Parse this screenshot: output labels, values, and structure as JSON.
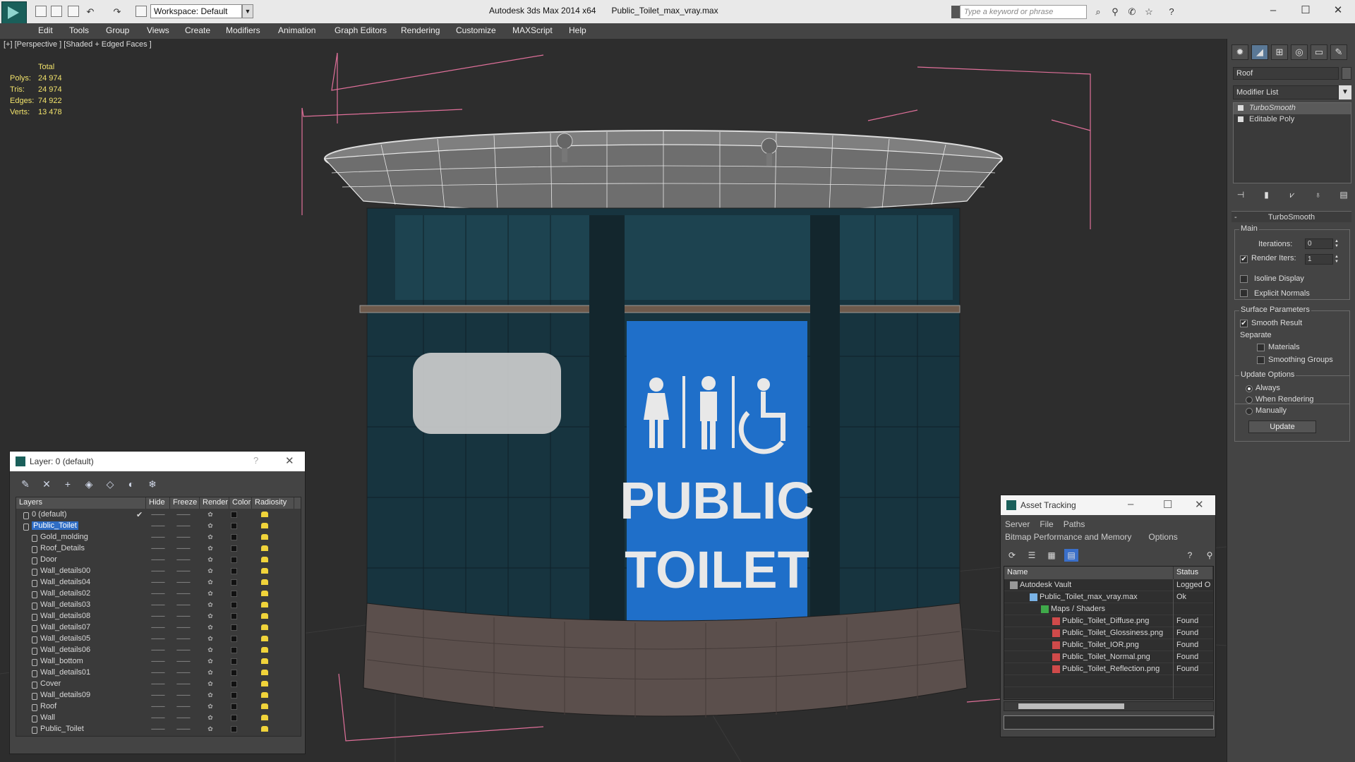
{
  "titlebar": {
    "workspace": "Workspace: Default",
    "app_title": "Autodesk 3ds Max  2014 x64",
    "file_name": "Public_Toilet_max_vray.max",
    "search_placeholder": "Type a keyword or phrase"
  },
  "menu": [
    "Edit",
    "Tools",
    "Group",
    "Views",
    "Create",
    "Modifiers",
    "Animation",
    "Graph Editors",
    "Rendering",
    "Customize",
    "MAXScript",
    "Help"
  ],
  "viewport": {
    "label": "[+] [Perspective ] [Shaded + Edged Faces ]",
    "stats": {
      "header": "Total",
      "rows": [
        {
          "k": "Polys:",
          "v": "24 974"
        },
        {
          "k": "Tris:",
          "v": "24 974"
        },
        {
          "k": "Edges:",
          "v": "74 922"
        },
        {
          "k": "Verts:",
          "v": "13 478"
        }
      ]
    },
    "sign": {
      "line1": "PUBLIC",
      "line2": "TOILET"
    }
  },
  "command_panel": {
    "object_name": "Roof",
    "modifier_list": "Modifier List",
    "stack": [
      "TurboSmooth",
      "Editable Poly"
    ],
    "rollout_title": "TurboSmooth",
    "main_group": "Main",
    "iterations_label": "Iterations:",
    "iterations_value": "0",
    "render_iters_label": "Render Iters:",
    "render_iters_value": "1",
    "isoline_display": "Isoline Display",
    "explicit_normals": "Explicit Normals",
    "surface_group": "Surface Parameters",
    "smooth_result": "Smooth Result",
    "separate_label": "Separate",
    "materials": "Materials",
    "smoothing_groups": "Smoothing Groups",
    "update_group": "Update Options",
    "always": "Always",
    "when_rendering": "When Rendering",
    "manually": "Manually",
    "update_button": "Update"
  },
  "layer_dialog": {
    "title": "Layer: 0 (default)",
    "help": "?",
    "columns": [
      "Layers",
      "Hide",
      "Freeze",
      "Render",
      "Color",
      "Radiosity"
    ],
    "layers": [
      {
        "name": "0 (default)",
        "level": 0,
        "check": "✔"
      },
      {
        "name": "Public_Toilet",
        "level": 0,
        "selected": true
      },
      {
        "name": "Gold_molding",
        "level": 1
      },
      {
        "name": "Roof_Details",
        "level": 1
      },
      {
        "name": "Door",
        "level": 1
      },
      {
        "name": "Wall_details00",
        "level": 1
      },
      {
        "name": "Wall_details04",
        "level": 1
      },
      {
        "name": "Wall_details02",
        "level": 1
      },
      {
        "name": "Wall_details03",
        "level": 1
      },
      {
        "name": "Wall_details08",
        "level": 1
      },
      {
        "name": "Wall_details07",
        "level": 1
      },
      {
        "name": "Wall_details05",
        "level": 1
      },
      {
        "name": "Wall_details06",
        "level": 1
      },
      {
        "name": "Wall_bottom",
        "level": 1
      },
      {
        "name": "Wall_details01",
        "level": 1
      },
      {
        "name": "Cover",
        "level": 1
      },
      {
        "name": "Wall_details09",
        "level": 1
      },
      {
        "name": "Roof",
        "level": 1
      },
      {
        "name": "Wall",
        "level": 1
      },
      {
        "name": "Public_Toilet",
        "level": 1
      }
    ]
  },
  "asset_tracking": {
    "title": "Asset Tracking",
    "menu1": [
      "Server",
      "File",
      "Paths"
    ],
    "menu2": [
      "Bitmap Performance and Memory",
      "Options"
    ],
    "columns": [
      "Name",
      "Status"
    ],
    "rows": [
      {
        "name": "Autodesk Vault",
        "status": "Logged O",
        "indent": 8,
        "icon": "vault"
      },
      {
        "name": "Public_Toilet_max_vray.max",
        "status": "Ok",
        "indent": 36,
        "icon": "max"
      },
      {
        "name": "Maps / Shaders",
        "status": "",
        "indent": 52,
        "icon": "folder"
      },
      {
        "name": "Public_Toilet_Diffuse.png",
        "status": "Found",
        "indent": 68,
        "icon": "png"
      },
      {
        "name": "Public_Toilet_Glossiness.png",
        "status": "Found",
        "indent": 68,
        "icon": "png"
      },
      {
        "name": "Public_Toilet_IOR.png",
        "status": "Found",
        "indent": 68,
        "icon": "png"
      },
      {
        "name": "Public_Toilet_Normal.png",
        "status": "Found",
        "indent": 68,
        "icon": "png"
      },
      {
        "name": "Public_Toilet_Reflection.png",
        "status": "Found",
        "indent": 68,
        "icon": "png"
      }
    ]
  }
}
